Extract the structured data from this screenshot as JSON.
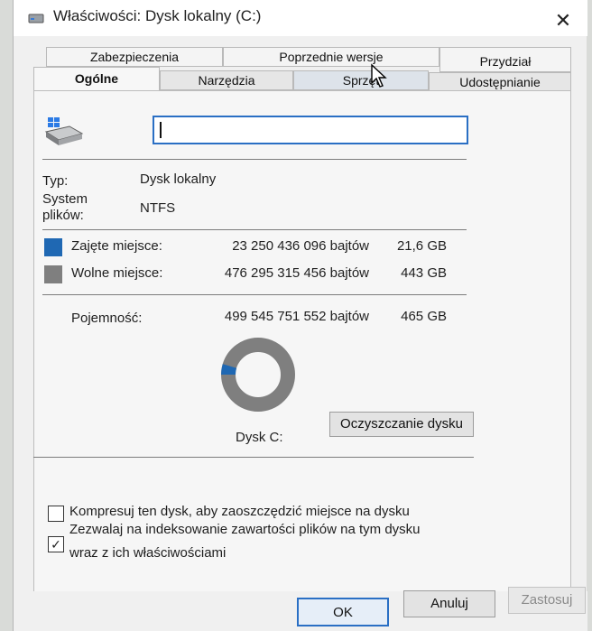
{
  "window": {
    "title": "Właściwości: Dysk lokalny (C:)",
    "close_symbol": "✕"
  },
  "tabs": {
    "row1": [
      "Zabezpieczenia",
      "Poprzednie wersje",
      "Przydział"
    ],
    "row2": [
      "Ogólne",
      "Narzędzia",
      "Sprzęt",
      "Udostępnianie"
    ]
  },
  "general": {
    "name_value": "",
    "type_label": "Typ:",
    "type_value": "Dysk lokalny",
    "fs_label": "System plików:",
    "fs_value": "NTFS",
    "used_label": "Zajęte miejsce:",
    "used_bytes": "23 250 436 096 bajtów",
    "used_human": "21,6 GB",
    "free_label": "Wolne miejsce:",
    "free_bytes": "476 295 315 456 bajtów",
    "free_human": "443 GB",
    "capacity_label": "Pojemność:",
    "capacity_bytes": "499 545 751 552 bajtów",
    "capacity_human": "465 GB",
    "used_fraction": 0.0465,
    "drive_label": "Dysk C:",
    "cleanup_button": "Oczyszczanie dysku",
    "compress_label": "Kompresuj ten dysk, aby zaoszczędzić miejsce na dysku",
    "compress_checked": false,
    "index_label_line1": "Zezwalaj na indeksowanie zawartości plików na tym dysku",
    "index_label_line2": "wraz z ich właściwościami",
    "index_checked": true,
    "check_symbol": "✓"
  },
  "buttons": {
    "ok": "OK",
    "cancel": "Anuluj",
    "apply": "Zastosuj"
  },
  "colors": {
    "used": "#1f68b3",
    "free": "#7f7f7f",
    "accent": "#2a6fc4"
  },
  "icons": {
    "title": "drive-icon",
    "drive": "windows-drive-icon",
    "close": "close-icon"
  }
}
